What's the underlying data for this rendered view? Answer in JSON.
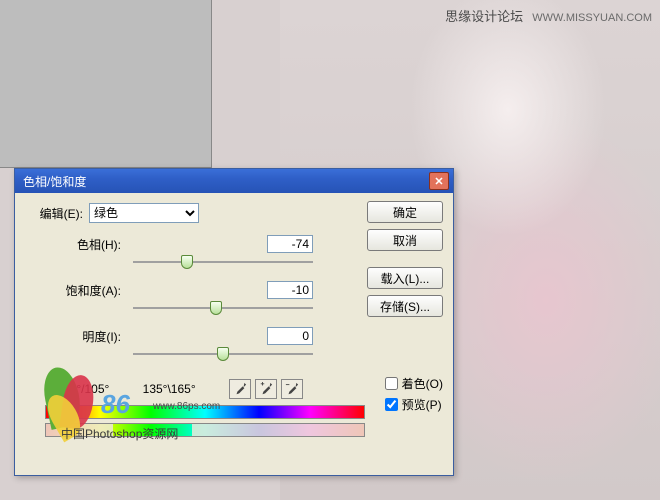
{
  "watermark": {
    "cn": "思缘设计论坛",
    "en": "WWW.MISSYUAN.COM"
  },
  "brand": {
    "big": "86",
    "url": "www.86ps.com",
    "sub": "中国Photoshop资源网"
  },
  "dialog": {
    "title": "色相/饱和度",
    "edit_label": "编辑(E):",
    "edit_value": "绿色",
    "sliders": {
      "hue": {
        "label": "色相(H):",
        "value": "-74",
        "pos_pct": 30
      },
      "saturation": {
        "label": "饱和度(A):",
        "value": "-10",
        "pos_pct": 46
      },
      "lightness": {
        "label": "明度(I):",
        "value": "0",
        "pos_pct": 50
      }
    },
    "range": {
      "left": "75°/105°",
      "right": "135°\\165°",
      "mask_left_pct": 21,
      "mask_right_pct": 46
    },
    "buttons": {
      "ok": "确定",
      "cancel": "取消",
      "load": "载入(L)...",
      "save": "存储(S)..."
    },
    "checks": {
      "colorize": {
        "label": "着色(O)",
        "checked": false
      },
      "preview": {
        "label": "预览(P)",
        "checked": true
      }
    }
  }
}
